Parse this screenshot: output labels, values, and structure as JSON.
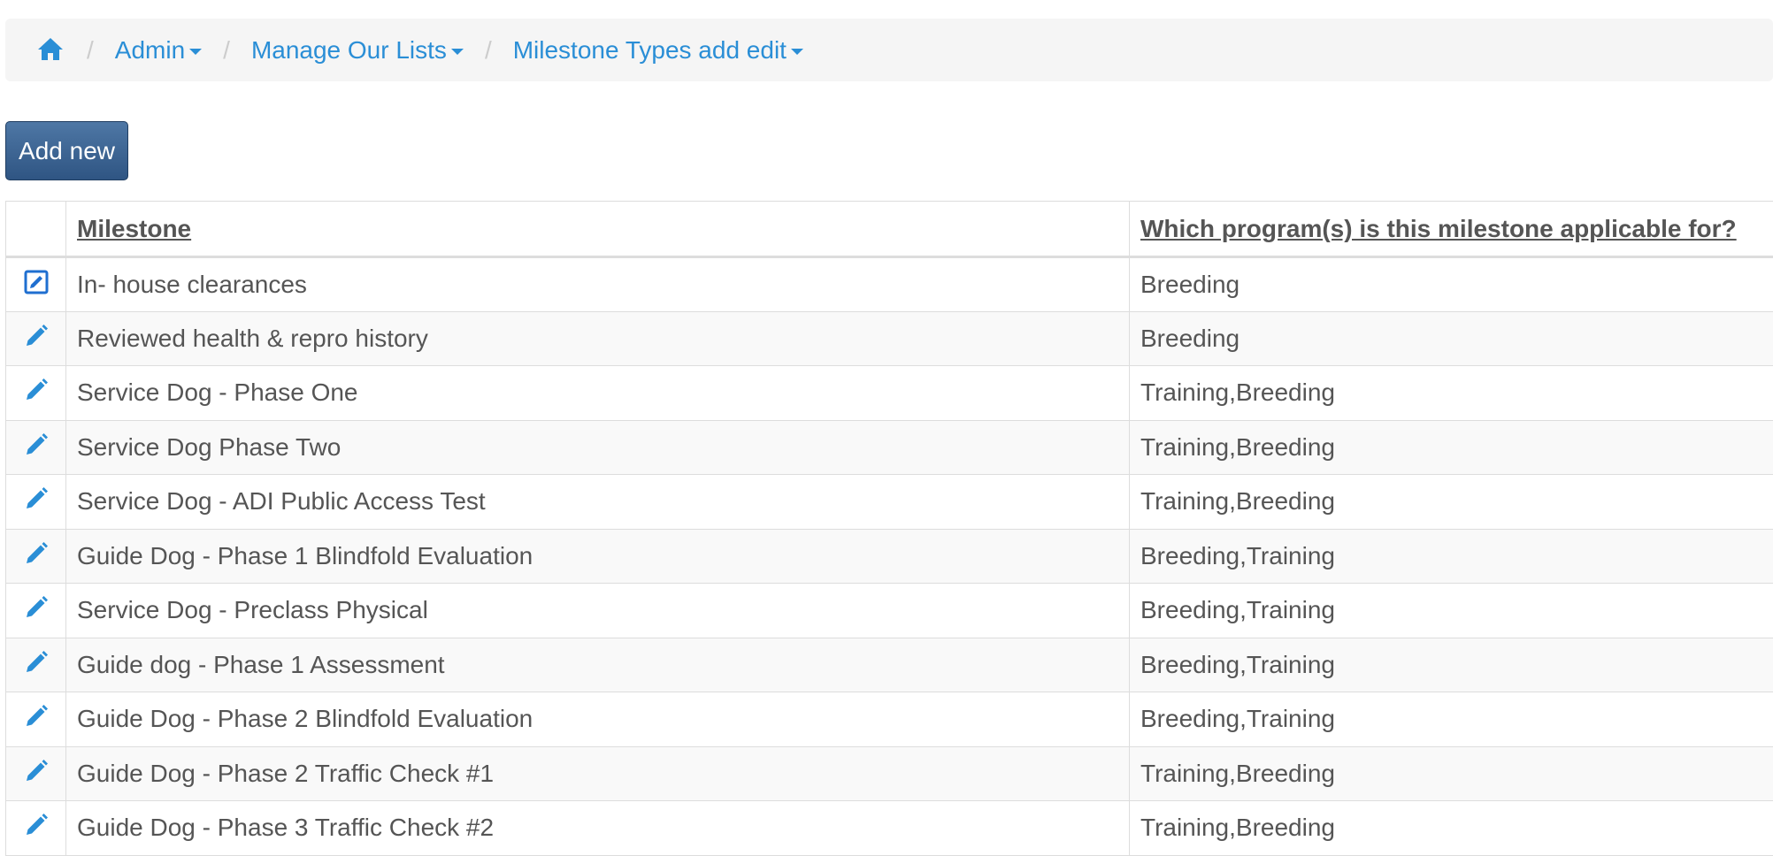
{
  "breadcrumb": {
    "home_icon": "home-icon",
    "items": [
      {
        "label": "Admin"
      },
      {
        "label": "Manage Our Lists"
      },
      {
        "label": "Milestone Types add edit"
      }
    ]
  },
  "toolbar": {
    "add_label": "Add new"
  },
  "table": {
    "columns": [
      "Milestone",
      "Which program(s) is this milestone applicable for?"
    ],
    "rows": [
      {
        "milestone": "In- house clearances",
        "programs": "Breeding",
        "icon": "edit-square-icon"
      },
      {
        "milestone": "Reviewed health & repro history",
        "programs": "Breeding",
        "icon": "pencil-icon"
      },
      {
        "milestone": "Service Dog - Phase One",
        "programs": "Training,Breeding",
        "icon": "pencil-icon"
      },
      {
        "milestone": "Service Dog Phase Two",
        "programs": "Training,Breeding",
        "icon": "pencil-icon"
      },
      {
        "milestone": "Service Dog - ADI Public Access Test",
        "programs": "Training,Breeding",
        "icon": "pencil-icon"
      },
      {
        "milestone": "Guide Dog - Phase 1 Blindfold Evaluation",
        "programs": "Breeding,Training",
        "icon": "pencil-icon"
      },
      {
        "milestone": "Service Dog - Preclass Physical",
        "programs": "Breeding,Training",
        "icon": "pencil-icon"
      },
      {
        "milestone": "Guide dog - Phase 1 Assessment",
        "programs": "Breeding,Training",
        "icon": "pencil-icon"
      },
      {
        "milestone": "Guide Dog - Phase 2 Blindfold Evaluation",
        "programs": "Breeding,Training",
        "icon": "pencil-icon"
      },
      {
        "milestone": "Guide Dog - Phase 2 Traffic Check #1",
        "programs": "Training,Breeding",
        "icon": "pencil-icon"
      },
      {
        "milestone": "Guide Dog - Phase 3 Traffic Check #2",
        "programs": "Training,Breeding",
        "icon": "pencil-icon"
      }
    ]
  },
  "colors": {
    "link": "#2a8ed6",
    "button": "#3a6290",
    "breadcrumb_bg": "#f5f5f5",
    "text": "#555555"
  }
}
